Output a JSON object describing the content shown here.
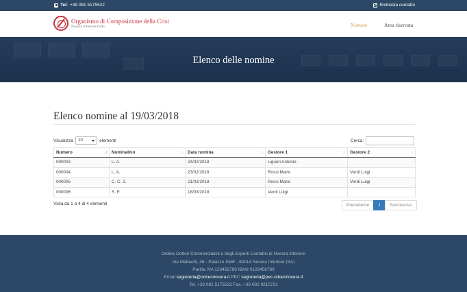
{
  "topbar": {
    "phone_label": "Tel:",
    "phone_number": "+39 081 5175522",
    "contact_link": "Richiesta contatto"
  },
  "header": {
    "logo_title": "Organismo di Composizione della Crisi",
    "logo_subtitle": "Nocera Inferiore (SA)",
    "nav": [
      {
        "label": "Nomine",
        "active": true
      },
      {
        "label": "Area riservata",
        "active": false
      }
    ],
    "accent_color": "#d4a15a",
    "brand_color": "#c8303a"
  },
  "hero": {
    "title": "Elenco delle nomine"
  },
  "main": {
    "title": "Elenco nomine al 19/03/2018",
    "length_label_before": "Visualizza",
    "length_value": "10",
    "length_label_after": "elementi",
    "search_label": "Cerca:",
    "search_value": "",
    "columns": [
      "Numero",
      "Nominativo",
      "Data nomina",
      "Gestore 1",
      "Gestore 2"
    ],
    "rows": [
      [
        "000003",
        "L. A.",
        "24/02/2018",
        "Liguori Antonio",
        ""
      ],
      [
        "000004",
        "L. A.",
        "23/02/2018",
        "Rossi Mario",
        "Verdi Luigi"
      ],
      [
        "000005",
        "C. C. 2.",
        "21/02/2018",
        "Rossi Mario",
        "Verdi Luigi"
      ],
      [
        "000006",
        "S. F.",
        "18/03/2018",
        "Verdi Luigi",
        ""
      ]
    ],
    "info": "Vista da 1 a 4 di 4 elementi",
    "pager": {
      "prev": "Precedente",
      "current": "1",
      "next": "Successivo"
    }
  },
  "footer": {
    "line1": "Ordine Dottori Commercialisti e degli Esperti Contabili di Nocera Inferiore",
    "line2": "Via Matteotti, 46 - Palazzo SME - 84014 Nocera Inferiore (SA)",
    "line3": "Partita IVA 123456789 IBAN 0123456789",
    "email_label": "Email",
    "email": "segreteria@odcecnocera.it",
    "pec_label": "PEC",
    "pec": "segreteria@pec.odcecnocera.it",
    "phones": "Tel. +39 081 5175522 Fax. +39 081 9210721"
  }
}
